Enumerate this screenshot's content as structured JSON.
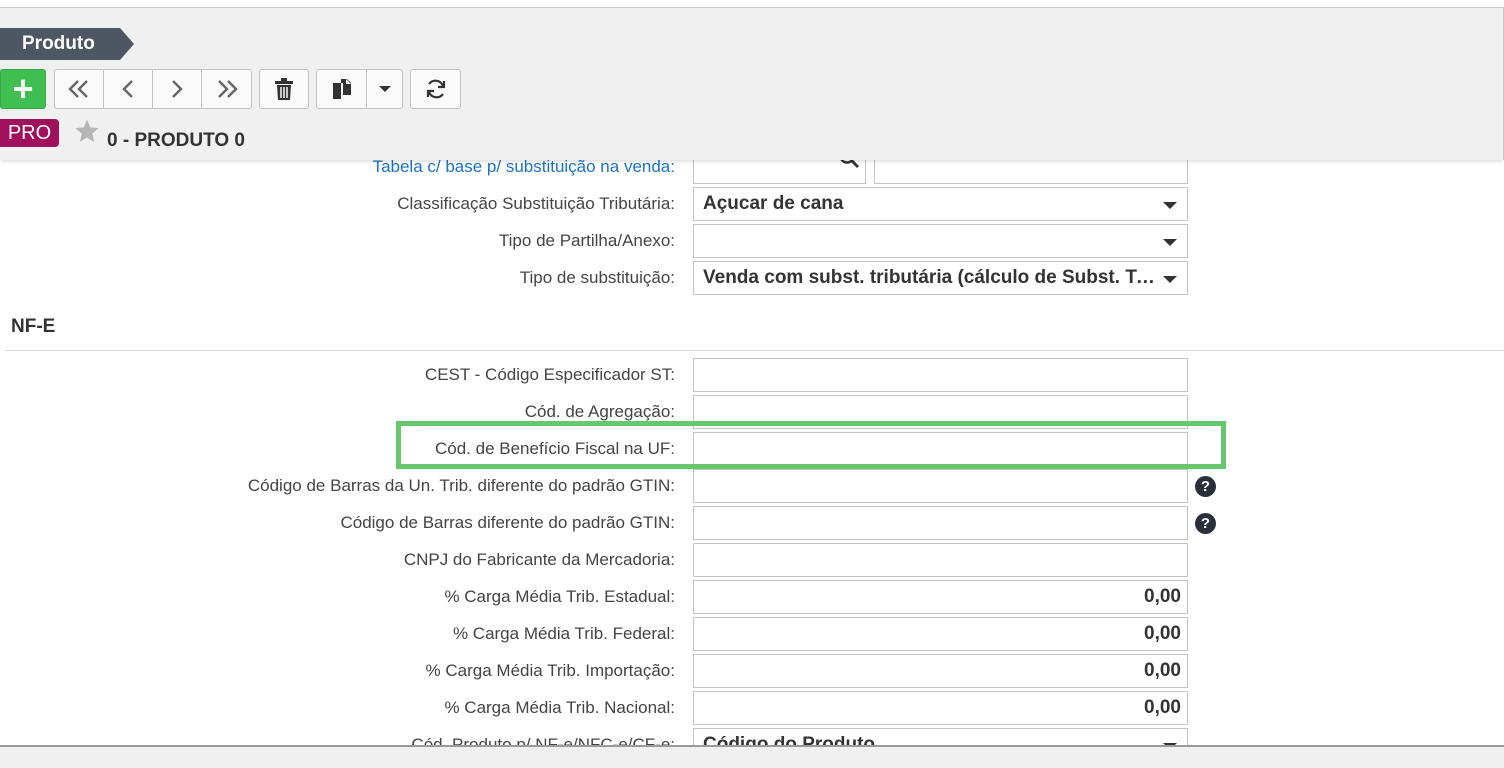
{
  "header": {
    "title": "Produto",
    "toolbar": {
      "add": "+",
      "first": "«",
      "prev": "‹",
      "next": "›",
      "last": "»"
    },
    "badge": "PRO",
    "record_title": "0 - PRODUTO 0"
  },
  "form": {
    "rows": [
      {
        "label": "Tabela c/ base p/ substituição na venda:",
        "value": ""
      },
      {
        "label": "Classificação Substituição Tributária:",
        "value": "Açucar de cana"
      },
      {
        "label": "Tipo de Partilha/Anexo:",
        "value": ""
      },
      {
        "label": "Tipo de substituição:",
        "value": "Venda com subst. tributária (cálculo de Subst. Tributária)"
      }
    ],
    "section_nfe": "NF-E",
    "nfe_rows": [
      {
        "label": "CEST - Código Especificador ST:",
        "value": ""
      },
      {
        "label": "Cód. de Agregação:",
        "value": ""
      },
      {
        "label": "Cód. de Benefício Fiscal na UF:",
        "value": ""
      },
      {
        "label": "Código de Barras da Un. Trib. diferente do padrão GTIN:",
        "value": "",
        "help": "?"
      },
      {
        "label": "Código de Barras diferente do padrão GTIN:",
        "value": "",
        "help": "?"
      },
      {
        "label": "CNPJ do Fabricante da Mercadoria:",
        "value": ""
      },
      {
        "label": "% Carga Média Trib. Estadual:",
        "value": "0,00"
      },
      {
        "label": "% Carga Média Trib. Federal:",
        "value": "0,00"
      },
      {
        "label": "% Carga Média Trib. Importação:",
        "value": "0,00"
      },
      {
        "label": "% Carga Média Trib. Nacional:",
        "value": "0,00"
      },
      {
        "label": "Cód. Produto p/ NF-e/NFC-e/CF-e:",
        "value": "Código do Produto"
      }
    ]
  },
  "colors": {
    "add_button": "#3fbf52",
    "badge": "#a0105c",
    "highlight": "#66c76e",
    "link": "#1a73c8"
  }
}
